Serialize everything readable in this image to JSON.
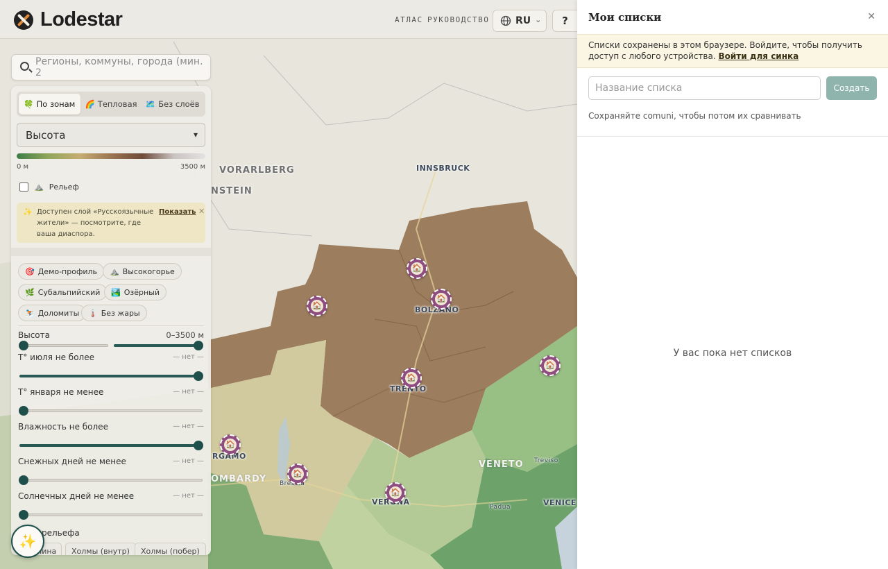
{
  "header": {
    "logo_text": "Lodestar",
    "nav": [
      "АТЛАС",
      "РУКОВОДСТВО"
    ],
    "lang": "RU",
    "lang_caret": "⌄",
    "help": "?"
  },
  "search": {
    "placeholder": "Регионы, коммуны, города (мин. 2"
  },
  "panel": {
    "modes": [
      {
        "icon": "🍀",
        "label": "По зонам",
        "active": true
      },
      {
        "icon": "🌈",
        "label": "Тепловая",
        "active": false
      },
      {
        "icon": "🗺️",
        "label": "Без слоёв",
        "active": false
      }
    ],
    "layer_select": "Высота",
    "layer_caret": "▾",
    "gradient_min": "0 м",
    "gradient_max": "3500 м",
    "relief_label": "Рельеф",
    "relief_icon": "⛰️",
    "notice": {
      "icon": "✨",
      "text": "Доступен слой «Русскоязычные жители» — посмотрите, где ваша диаспора.",
      "action": "Показать",
      "close": "✕"
    },
    "presets": [
      {
        "icon": "🎯",
        "label": "Демо-профиль"
      },
      {
        "icon": "⛰️",
        "label": "Высокогорье"
      },
      {
        "icon": "🌿",
        "label": "Субальпийский"
      },
      {
        "icon": "🏞️",
        "label": "Озёрный"
      },
      {
        "icon": "⛷️",
        "label": "Доломиты"
      },
      {
        "icon": "🌡️",
        "label": "Без жары"
      }
    ],
    "filters": [
      {
        "label": "Высота",
        "value": "0–3500 м"
      },
      {
        "label": "T° июля не более",
        "value": "— нет —"
      },
      {
        "label": "T° января не менее",
        "value": "— нет —"
      },
      {
        "label": "Влажность не более",
        "value": "— нет —"
      },
      {
        "label": "Снежных дней не менее",
        "value": "— нет —"
      },
      {
        "label": "Солнечных дней не менее",
        "value": "— нет —"
      }
    ],
    "relief_type_label": "рельефа",
    "relief_types": [
      "нина",
      "Холмы (внутр)",
      "Холмы (побер)"
    ],
    "magic_icon": "✨"
  },
  "map": {
    "labels": [
      {
        "text": "VORARLBERG",
        "kind": "big"
      },
      {
        "text": "INNSBRUCK",
        "kind": "city"
      },
      {
        "text": "NSTEIN",
        "kind": "big"
      },
      {
        "text": "BOLZANO",
        "kind": "city"
      },
      {
        "text": "TRENTO",
        "kind": "city"
      },
      {
        "text": "RGAMO",
        "kind": "city"
      },
      {
        "text": "OMBARDY",
        "kind": "region"
      },
      {
        "text": "Brescia",
        "kind": "small"
      },
      {
        "text": "VERONA",
        "kind": "city"
      },
      {
        "text": "VENETO",
        "kind": "region"
      },
      {
        "text": "Treviso",
        "kind": "small"
      },
      {
        "text": "Padua",
        "kind": "small"
      },
      {
        "text": "VENICE",
        "kind": "city"
      }
    ],
    "marker_icon": "🏠"
  },
  "drawer": {
    "title": "Мои списки",
    "close": "✕",
    "banner_text": "Списки сохранены в этом браузере. Войдите, чтобы получить доступ с любого устройства.",
    "banner_link": "Войти для синка",
    "input_placeholder": "Название списка",
    "create": "Создать",
    "hint": "Сохраняйте comuni, чтобы потом их сравнивать",
    "empty": "У вас пока нет списков"
  }
}
